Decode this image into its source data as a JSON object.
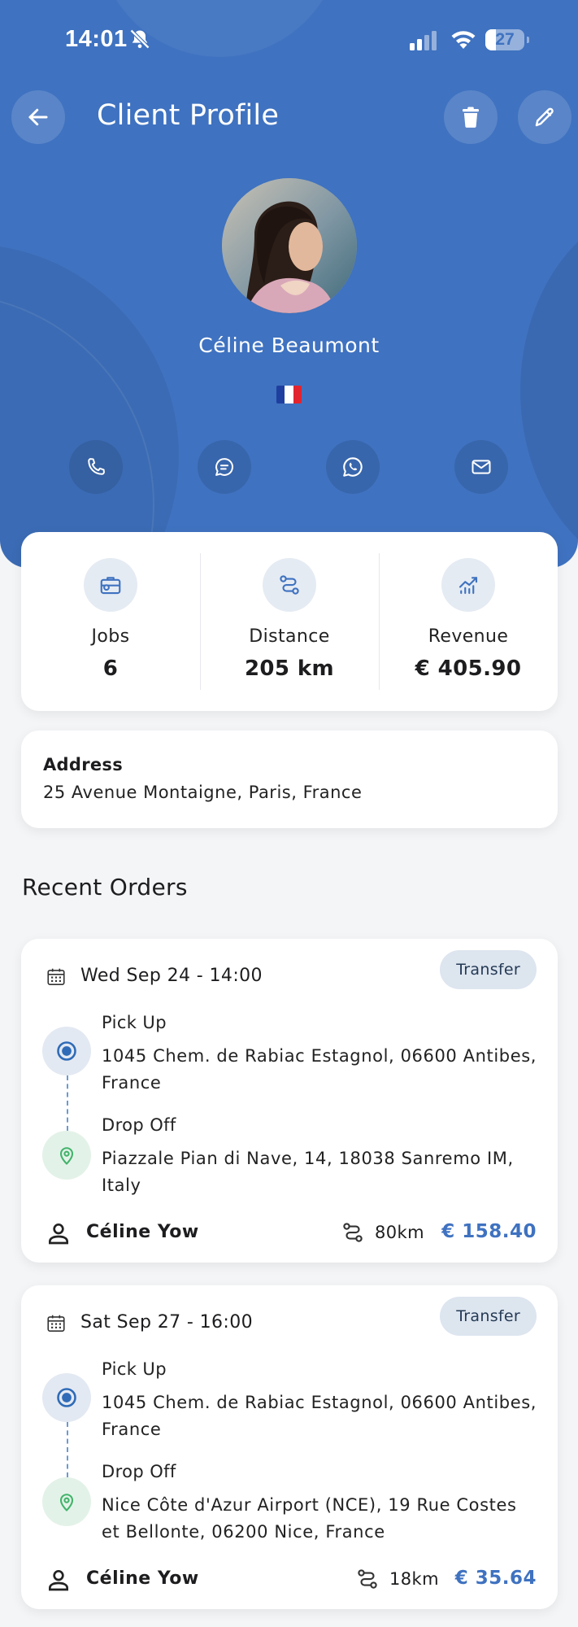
{
  "status_bar": {
    "time": "14:01",
    "battery": "27",
    "battery_level": 0.27
  },
  "header": {
    "title": "Client Profile"
  },
  "client": {
    "name": "Céline Beaumont",
    "flag": "france-flag"
  },
  "colors": {
    "primary": "#3f72c0",
    "pickup": "#2f6bb7",
    "dropoff": "#42b36b"
  },
  "stats": [
    {
      "label": "Jobs",
      "value": "6",
      "icon": "briefcase-icon"
    },
    {
      "label": "Distance",
      "value": "205 km",
      "icon": "route-icon"
    },
    {
      "label": "Revenue",
      "value": "€ 405.90",
      "icon": "chart-up-icon"
    }
  ],
  "address": {
    "label": "Address",
    "value": "25 Avenue Montaigne, Paris, France"
  },
  "recent_orders": {
    "title": "Recent Orders",
    "items": [
      {
        "datetime": "Wed Sep 24 - 14:00",
        "type": "Transfer",
        "pickup_label": "Pick Up",
        "pickup": "1045 Chem. de Rabiac Estagnol, 06600 Antibes, France",
        "dropoff_label": "Drop Off",
        "dropoff": "Piazzale Pian di Nave, 14, 18038 Sanremo IM, Italy",
        "driver": "Céline Yow",
        "distance": "80km",
        "price": "€ 158.40"
      },
      {
        "datetime": "Sat Sep 27 - 16:00",
        "type": "Transfer",
        "pickup_label": "Pick Up",
        "pickup": "1045 Chem. de Rabiac Estagnol, 06600 Antibes, France",
        "dropoff_label": "Drop Off",
        "dropoff": "Nice Côte d'Azur Airport (NCE), 19 Rue Costes et Bellonte, 06200 Nice, France",
        "driver": "Céline Yow",
        "distance": "18km",
        "price": "€ 35.64"
      }
    ]
  }
}
